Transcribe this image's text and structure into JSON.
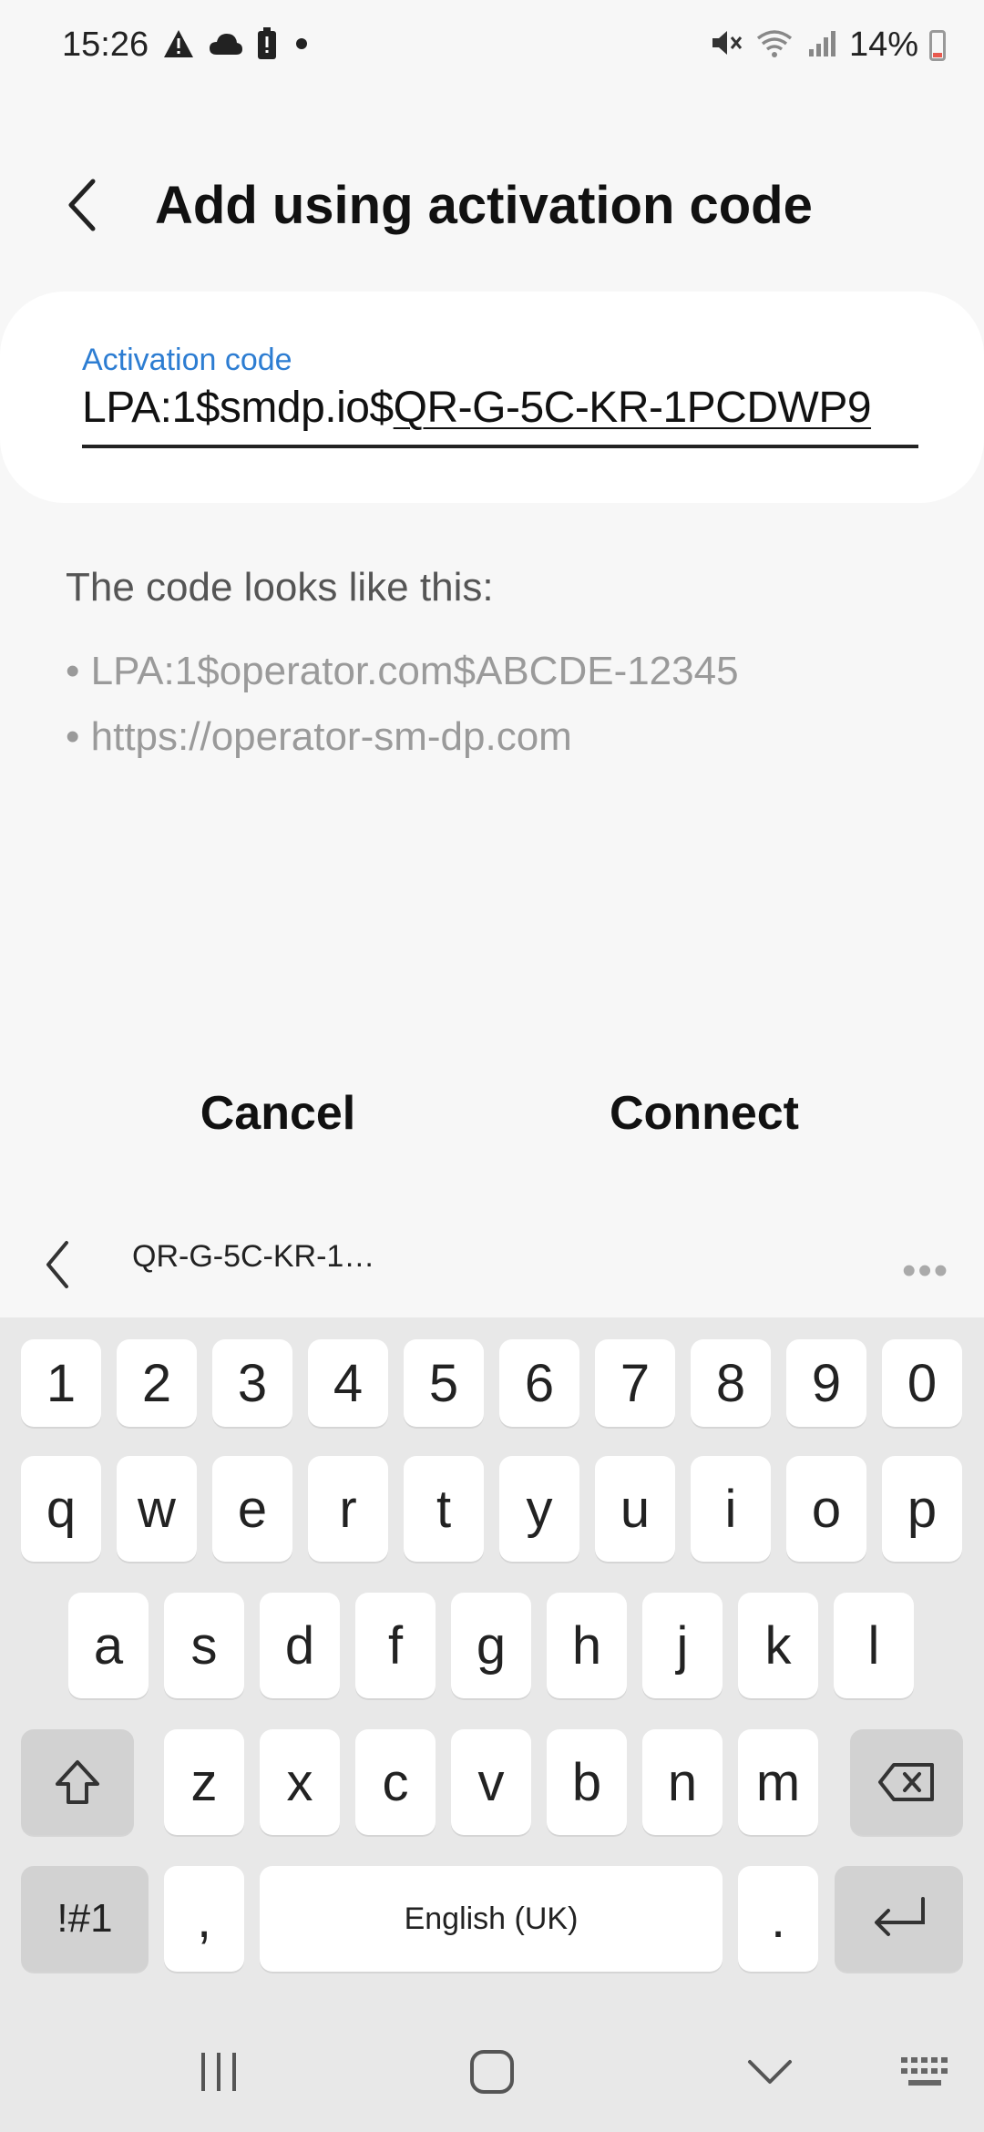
{
  "status_bar": {
    "time": "15:26",
    "battery": "14%",
    "left_icons": [
      "warning-icon",
      "cloud-icon",
      "battery-alert-icon",
      "dot-icon"
    ],
    "right_icons": [
      "mute-icon",
      "wifi-icon",
      "signal-icon",
      "battery-icon"
    ]
  },
  "header": {
    "title": "Add using activation code"
  },
  "field": {
    "label": "Activation code",
    "value_prefix": "LPA:1$smdp.io$",
    "value_underlined": "QR-G-5C-KR-1PCDWP9"
  },
  "help": {
    "title": "The code looks like this:",
    "examples": [
      "• LPA:1$operator.com$ABCDE-12345",
      "• https://operator-sm-dp.com"
    ]
  },
  "buttons": {
    "cancel": "Cancel",
    "connect": "Connect"
  },
  "suggestion": {
    "text": "QR-G-5C-KR-1…",
    "more": "•••"
  },
  "keyboard": {
    "row_numbers": [
      "1",
      "2",
      "3",
      "4",
      "5",
      "6",
      "7",
      "8",
      "9",
      "0"
    ],
    "row1": [
      "q",
      "w",
      "e",
      "r",
      "t",
      "y",
      "u",
      "i",
      "o",
      "p"
    ],
    "row2": [
      "a",
      "s",
      "d",
      "f",
      "g",
      "h",
      "j",
      "k",
      "l"
    ],
    "row3": [
      "z",
      "x",
      "c",
      "v",
      "b",
      "n",
      "m"
    ],
    "symbols_label": "!#1",
    "comma": ",",
    "space_label": "English (UK)",
    "period": "."
  },
  "colors": {
    "accent": "#2d7dd2",
    "background": "#f7f7f7",
    "keyboard_bg": "#e8e8e8"
  }
}
